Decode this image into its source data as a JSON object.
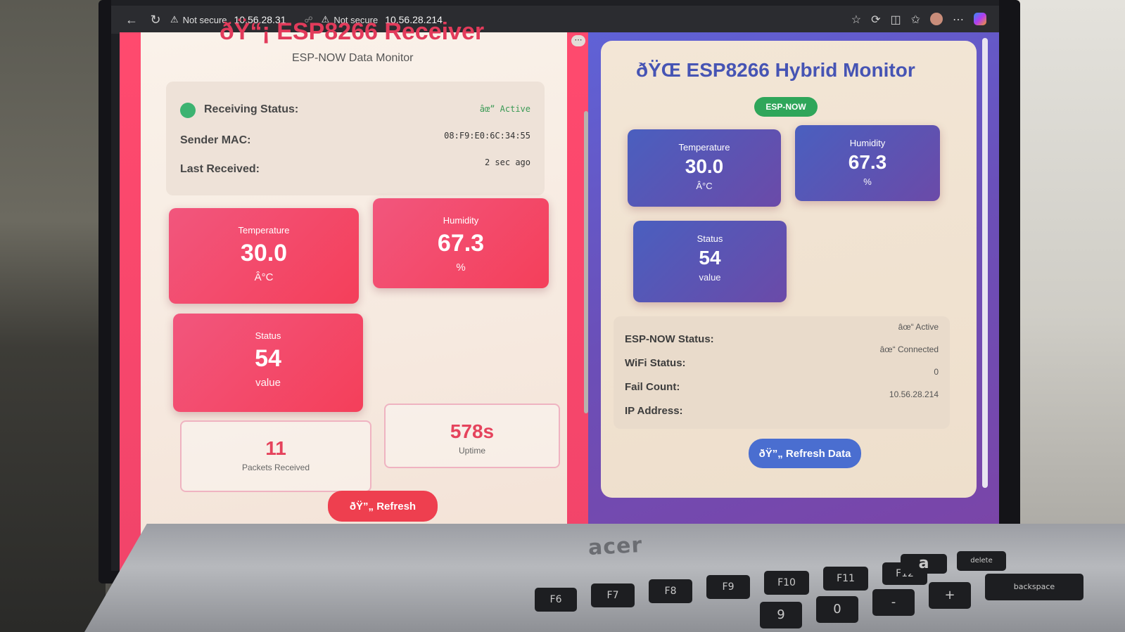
{
  "browser": {
    "tab1": {
      "security": "Not secure",
      "url": "10.56.28.31"
    },
    "tab2": {
      "security": "Not secure",
      "url": "10.56.28.214"
    }
  },
  "receiver": {
    "title": "ðŸ“¡ ESP8266 Receiver",
    "subtitle": "ESP-NOW Data Monitor",
    "receiving_status_label": "Receiving Status:",
    "receiving_status_value": "âœ” Active",
    "sender_mac_label": "Sender MAC:",
    "sender_mac_value": "08:F9:E0:6C:34:55",
    "last_received_label": "Last Received:",
    "last_received_value": "2 sec ago",
    "temperature": {
      "label": "Temperature",
      "value": "30.0",
      "unit": "Â°C"
    },
    "humidity": {
      "label": "Humidity",
      "value": "67.3",
      "unit": "%"
    },
    "status": {
      "label": "Status",
      "value": "54",
      "unit": "value"
    },
    "packets": {
      "value": "11",
      "label": "Packets Received"
    },
    "uptime": {
      "value": "578s",
      "label": "Uptime"
    },
    "refresh_label": "ðŸ”„ Refresh"
  },
  "hybrid": {
    "title": "ðŸŒ ESP8266 Hybrid Monitor",
    "badge": "ESP-NOW",
    "temperature": {
      "label": "Temperature",
      "value": "30.0",
      "unit": "Â°C"
    },
    "humidity": {
      "label": "Humidity",
      "value": "67.3",
      "unit": "%"
    },
    "status": {
      "label": "Status",
      "value": "54",
      "unit": "value"
    },
    "espnow_status_label": "ESP-NOW Status:",
    "espnow_status_value": "âœ“ Active",
    "wifi_status_label": "WiFi Status:",
    "wifi_status_value": "âœ“ Connected",
    "fail_count_label": "Fail Count:",
    "fail_count_value": "0",
    "ip_label": "IP Address:",
    "ip_value": "10.56.28.214",
    "refresh_label": "ðŸ”„ Refresh Data"
  },
  "laptop": {
    "brand": "acer"
  },
  "keyboard": {
    "keys": [
      "F6",
      "F7",
      "F8",
      "F9",
      "F10",
      "F11",
      "F12",
      "a",
      "delete",
      "9",
      "0",
      "-",
      "+",
      "backspace"
    ]
  },
  "colors": {
    "pink_accent": "#f2567d",
    "blue_accent": "#4a5fbf",
    "green_status": "#3cb371"
  }
}
